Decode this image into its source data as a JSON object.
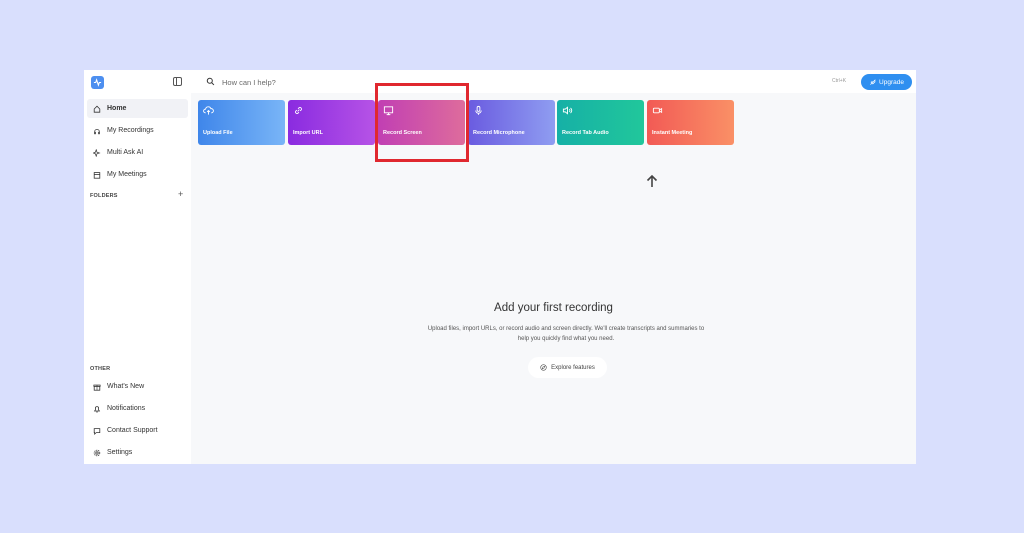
{
  "search": {
    "placeholder": "How can I help?",
    "shortcut": "Ctrl+K"
  },
  "header": {
    "upgrade_label": "Upgrade"
  },
  "sidebar": {
    "nav": [
      {
        "label": "Home",
        "icon": "home-icon",
        "active": true
      },
      {
        "label": "My Recordings",
        "icon": "recordings-icon"
      },
      {
        "label": "Multi Ask AI",
        "icon": "sparkle-icon"
      },
      {
        "label": "My Meetings",
        "icon": "calendar-icon"
      }
    ],
    "folders_label": "FOLDERS",
    "other_label": "OTHER",
    "other": [
      {
        "label": "What's New",
        "icon": "gift-icon"
      },
      {
        "label": "Notifications",
        "icon": "bell-icon"
      },
      {
        "label": "Contact Support",
        "icon": "chat-icon"
      },
      {
        "label": "Settings",
        "icon": "gear-icon"
      }
    ]
  },
  "actions": [
    {
      "label": "Upload File",
      "icon": "cloud-upload-icon",
      "color_from": "#3f86ea",
      "color_to": "#79b5f7"
    },
    {
      "label": "Import URL",
      "icon": "link-icon",
      "color_from": "#8a2be0",
      "color_to": "#b653e6"
    },
    {
      "label": "Record Screen",
      "icon": "monitor-icon",
      "color_from": "#c13fb3",
      "color_to": "#de6c9c"
    },
    {
      "label": "Record Microphone",
      "icon": "microphone-icon",
      "color_from": "#6a5be0",
      "color_to": "#8f9df1"
    },
    {
      "label": "Record Tab Audio",
      "icon": "speaker-icon",
      "color_from": "#16b0a6",
      "color_to": "#21c79b"
    },
    {
      "label": "Instant Meeting",
      "icon": "video-camera-icon",
      "color_from": "#f25a55",
      "color_to": "#fa9066"
    }
  ],
  "empty_state": {
    "title": "Add your first recording",
    "description": "Upload files, import URLs, or record audio and screen directly. We'll create transcripts and summaries to help you quickly find what you need.",
    "explore_label": "Explore features"
  },
  "colors": {
    "page_bg": "#d9dffd",
    "accent": "#2f8ff0",
    "highlight": "#e0282f"
  }
}
